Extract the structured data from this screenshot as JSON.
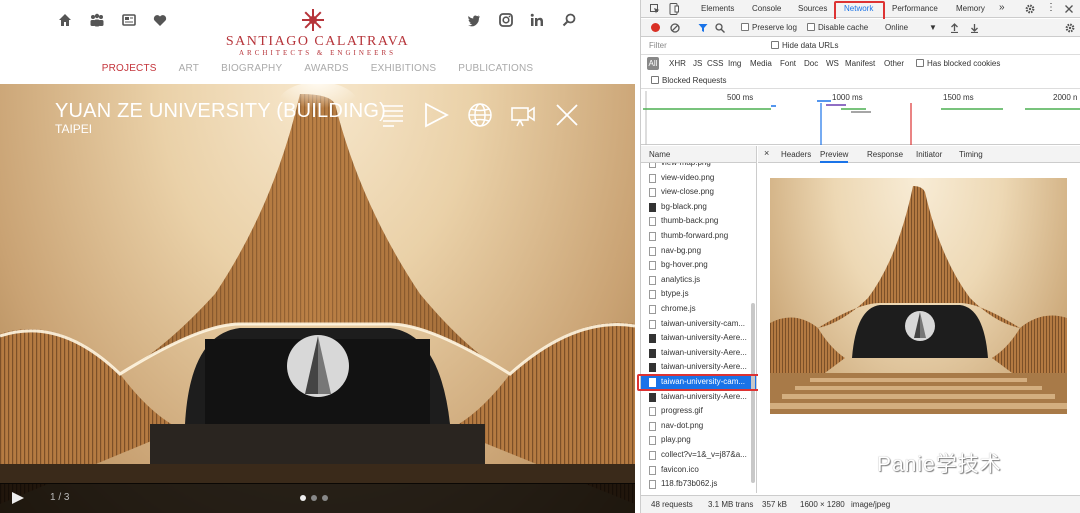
{
  "site": {
    "logo_name": "SANTIAGO CALATRAVA",
    "logo_subtitle": "ARCHITECTS & ENGINEERS",
    "header_icons_left": [
      "home-icon",
      "people-icon",
      "news-icon",
      "heart-icon"
    ],
    "header_icons_right": [
      "twitter-icon",
      "instagram-icon",
      "linkedin-icon",
      "search-icon"
    ],
    "nav": [
      "PROJECTS",
      "ART",
      "BIOGRAPHY",
      "AWARDS",
      "EXHIBITIONS",
      "PUBLICATIONS"
    ],
    "active_nav": "PROJECTS",
    "accent_color": "#c4343b",
    "hero": {
      "title": "YUAN ZE UNIVERSITY (BUILDING)",
      "subtitle": "TAIPEI",
      "controls": [
        "text-icon",
        "play-triangle-icon",
        "globe-icon",
        "video-camera-icon",
        "close-icon"
      ],
      "slide_counter": "1 / 3",
      "slide_count": 3,
      "current_slide": 1
    }
  },
  "devtools": {
    "tabs": [
      "Elements",
      "Console",
      "Sources",
      "Network",
      "Performance",
      "Memory",
      "»"
    ],
    "active_tab": "Network",
    "toolbar": {
      "preserve_log": "Preserve log",
      "disable_cache": "Disable cache",
      "throttle": "Online"
    },
    "filter": {
      "placeholder": "Filter",
      "hide_data_urls": "Hide data URLs"
    },
    "types": [
      "All",
      "XHR",
      "JS",
      "CSS",
      "Img",
      "Media",
      "Font",
      "Doc",
      "WS",
      "Manifest",
      "Other"
    ],
    "has_blocked_cookies": "Has blocked cookies",
    "blocked_requests": "Blocked Requests",
    "timeline_labels": [
      "500 ms",
      "1000 ms",
      "1500 ms",
      "2000 n"
    ],
    "list_header": "Name",
    "requests": [
      "view-map.png",
      "view-video.png",
      "view-close.png",
      "bg-black.png",
      "thumb-back.png",
      "thumb-forward.png",
      "nav-bg.png",
      "bg-hover.png",
      "analytics.js",
      "btype.js",
      "chrome.js",
      "taiwan-university-cam...",
      "taiwan-university-Aere...",
      "taiwan-university-Aere...",
      "taiwan-university-Aere...",
      "taiwan-university-cam...",
      "taiwan-university-Aere...",
      "progress.gif",
      "nav-dot.png",
      "play.png",
      "collect?v=1&_v=j87&a...",
      "favicon.ico",
      "118.fb73b062.js"
    ],
    "selected_request_index": 15,
    "detail_tabs": [
      "×",
      "Headers",
      "Preview",
      "Response",
      "Initiator",
      "Timing"
    ],
    "active_detail_tab": "Preview",
    "status": {
      "requests": "48 requests",
      "transferred": "3.1 MB trans",
      "size": "357 kB",
      "dimensions": "1600 × 1280",
      "mime": "image/jpeg"
    },
    "watermark": "Panie学技术"
  }
}
